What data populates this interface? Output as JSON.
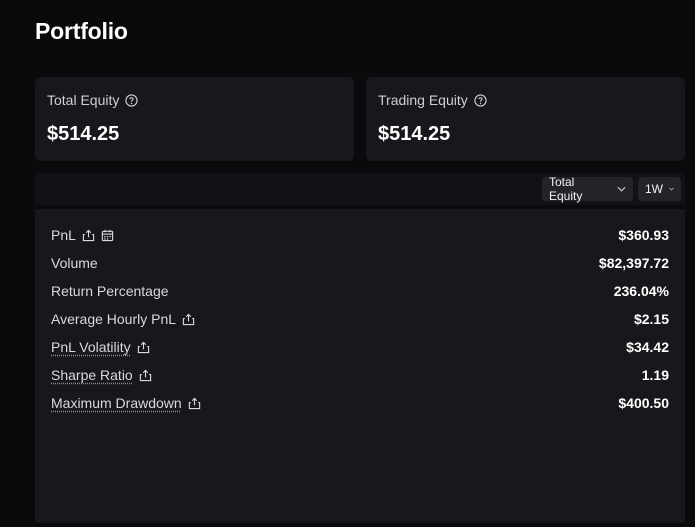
{
  "page": {
    "title": "Portfolio"
  },
  "cards": [
    {
      "label": "Total Equity",
      "value": "$514.25"
    },
    {
      "label": "Trading Equity",
      "value": "$514.25"
    }
  ],
  "toolbar": {
    "metric_select": "Total Equity",
    "range_select": "1W"
  },
  "stats": [
    {
      "label": "PnL",
      "value": "$360.93",
      "share": true,
      "calendar": true,
      "underline": false
    },
    {
      "label": "Volume",
      "value": "$82,397.72",
      "share": false,
      "calendar": false,
      "underline": false
    },
    {
      "label": "Return Percentage",
      "value": "236.04%",
      "share": false,
      "calendar": false,
      "underline": false
    },
    {
      "label": "Average Hourly PnL",
      "value": "$2.15",
      "share": true,
      "calendar": false,
      "underline": false
    },
    {
      "label": "PnL Volatility",
      "value": "$34.42",
      "share": true,
      "calendar": false,
      "underline": true
    },
    {
      "label": "Sharpe Ratio",
      "value": "1.19",
      "share": true,
      "calendar": false,
      "underline": true
    },
    {
      "label": "Maximum Drawdown",
      "value": "$400.50",
      "share": true,
      "calendar": false,
      "underline": true
    }
  ],
  "icons": {
    "help": "help-circle-icon",
    "share": "share-icon",
    "calendar": "calendar-icon",
    "dropdown": "chevron-down-icon"
  },
  "colors": {
    "background": "#0a0a0d",
    "card": "#17171c",
    "text": "#ffffff"
  }
}
